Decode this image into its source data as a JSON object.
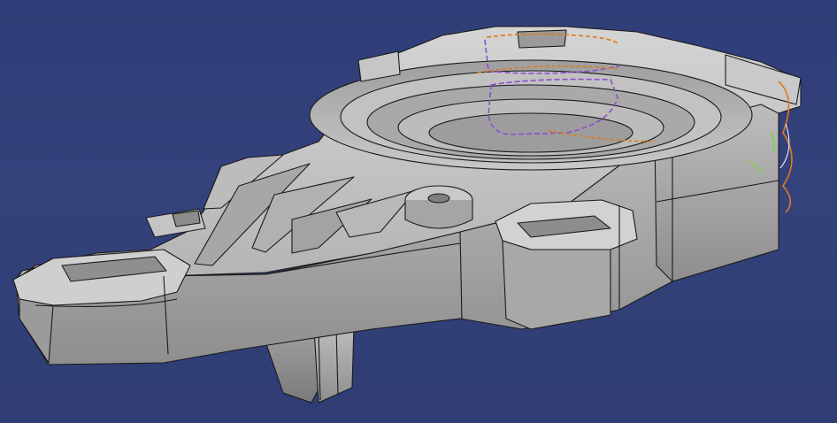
{
  "viewport": {
    "background_color": "#34427c",
    "part_color": "#b9b9b9",
    "edge_color": "#1a1a1a",
    "highlight_colors": [
      "#e07a18",
      "#8a4fd0",
      "#7ad04a",
      "#ffffff"
    ]
  },
  "model": {
    "icon": "cast-housing-part",
    "features": [
      "bearing-bore",
      "mounting-lug",
      "rib",
      "boss",
      "pocket"
    ]
  }
}
